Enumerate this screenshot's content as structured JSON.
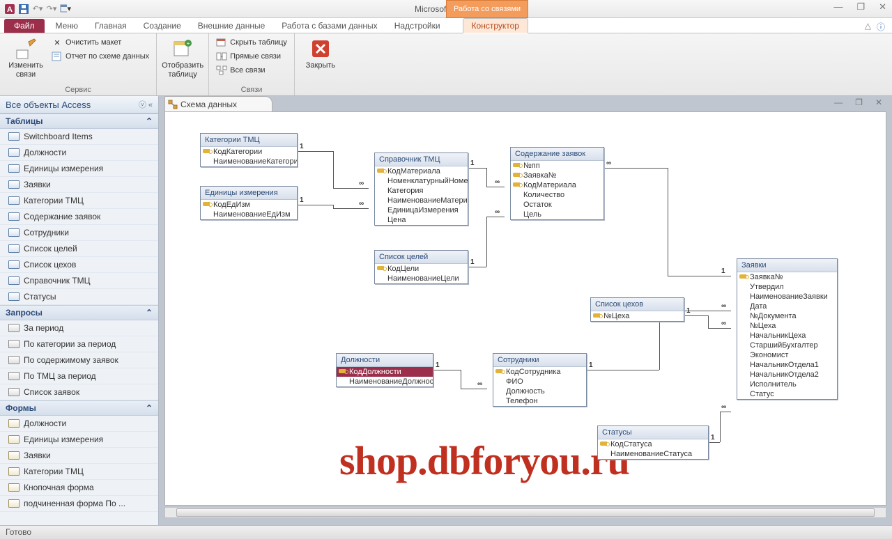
{
  "app": {
    "title": "Microsoft Access",
    "context_tab": "Работа со связями"
  },
  "tabs": {
    "file": "Файл",
    "items": [
      "Меню",
      "Главная",
      "Создание",
      "Внешние данные",
      "Работа с базами данных",
      "Надстройки"
    ],
    "constructor": "Конструктор"
  },
  "ribbon": {
    "group1": {
      "label": "Сервис",
      "btn_edit": "Изменить связи",
      "btn_clear": "Очистить макет",
      "btn_report": "Отчет по схеме данных"
    },
    "group2": {
      "label": "",
      "btn_show": "Отобразить таблицу"
    },
    "group3": {
      "label": "Связи",
      "btn_hide": "Скрыть таблицу",
      "btn_direct": "Прямые связи",
      "btn_all": "Все связи"
    },
    "group4": {
      "btn_close": "Закрыть"
    }
  },
  "nav": {
    "header": "Все объекты Access",
    "g_tables": "Таблицы",
    "tables": [
      "Switchboard Items",
      "Должности",
      "Единицы измерения",
      "Заявки",
      "Категории ТМЦ",
      "Содержание заявок",
      "Сотрудники",
      "Список целей",
      "Список цехов",
      "Справочник ТМЦ",
      "Статусы"
    ],
    "g_queries": "Запросы",
    "queries": [
      "За период",
      "По категории за период",
      "По содержимому заявок",
      "По ТМЦ за период",
      "Список заявок"
    ],
    "g_forms": "Формы",
    "forms": [
      "Должности",
      "Единицы измерения",
      "Заявки",
      "Категории ТМЦ",
      "Кнопочная форма",
      "подчиненная форма По ..."
    ]
  },
  "doc": {
    "title": "Схема данных"
  },
  "tables_canvas": {
    "t1": {
      "title": "Категории ТМЦ",
      "fields": [
        {
          "n": "КодКатегории",
          "k": 1
        },
        {
          "n": "НаименованиеКатегории"
        }
      ]
    },
    "t2": {
      "title": "Единицы измерения",
      "fields": [
        {
          "n": "КодЕдИзм",
          "k": 1
        },
        {
          "n": "НаименованиеЕдИзм"
        }
      ]
    },
    "t3": {
      "title": "Справочник ТМЦ",
      "fields": [
        {
          "n": "КодМатериала",
          "k": 1
        },
        {
          "n": "НоменклатурныйНомер"
        },
        {
          "n": "Категория"
        },
        {
          "n": "НаименованиеМатериала"
        },
        {
          "n": "ЕдиницаИзмерения"
        },
        {
          "n": "Цена"
        }
      ]
    },
    "t4": {
      "title": "Содержание заявок",
      "fields": [
        {
          "n": "№пп",
          "k": 1
        },
        {
          "n": "Заявка№",
          "k": 1
        },
        {
          "n": "КодМатериала",
          "k": 1
        },
        {
          "n": "Количество"
        },
        {
          "n": "Остаток"
        },
        {
          "n": "Цель"
        }
      ]
    },
    "t5": {
      "title": "Список целей",
      "fields": [
        {
          "n": "КодЦели",
          "k": 1
        },
        {
          "n": "НаименованиеЦели"
        }
      ]
    },
    "t6": {
      "title": "Должности",
      "fields": [
        {
          "n": "КодДолжности",
          "k": 1,
          "sel": 1
        },
        {
          "n": "НаименованиеДолжности"
        }
      ]
    },
    "t7": {
      "title": "Сотрудники",
      "fields": [
        {
          "n": "КодСотрудника",
          "k": 1
        },
        {
          "n": "ФИО"
        },
        {
          "n": "Должность"
        },
        {
          "n": "Телефон"
        }
      ]
    },
    "t8": {
      "title": "Список цехов",
      "fields": [
        {
          "n": "№Цеха",
          "k": 1
        }
      ]
    },
    "t9": {
      "title": "Статусы",
      "fields": [
        {
          "n": "КодСтатуса",
          "k": 1
        },
        {
          "n": "НаименованиеСтатуса"
        }
      ]
    },
    "t10": {
      "title": "Заявки",
      "fields": [
        {
          "n": "Заявка№",
          "k": 1
        },
        {
          "n": "Утвердил"
        },
        {
          "n": "НаименованиеЗаявки"
        },
        {
          "n": "Дата"
        },
        {
          "n": "№Документа"
        },
        {
          "n": "№Цеха"
        },
        {
          "n": "НачальникЦеха"
        },
        {
          "n": "СтаршийБухгалтер"
        },
        {
          "n": "Экономист"
        },
        {
          "n": "НачальникОтдела1"
        },
        {
          "n": "НачальникОтдела2"
        },
        {
          "n": "Исполнитель"
        },
        {
          "n": "Статус"
        }
      ]
    }
  },
  "rel_labels": {
    "one": "1",
    "inf": "∞"
  },
  "status": "Готово",
  "watermark": "shop.dbforyou.ru"
}
